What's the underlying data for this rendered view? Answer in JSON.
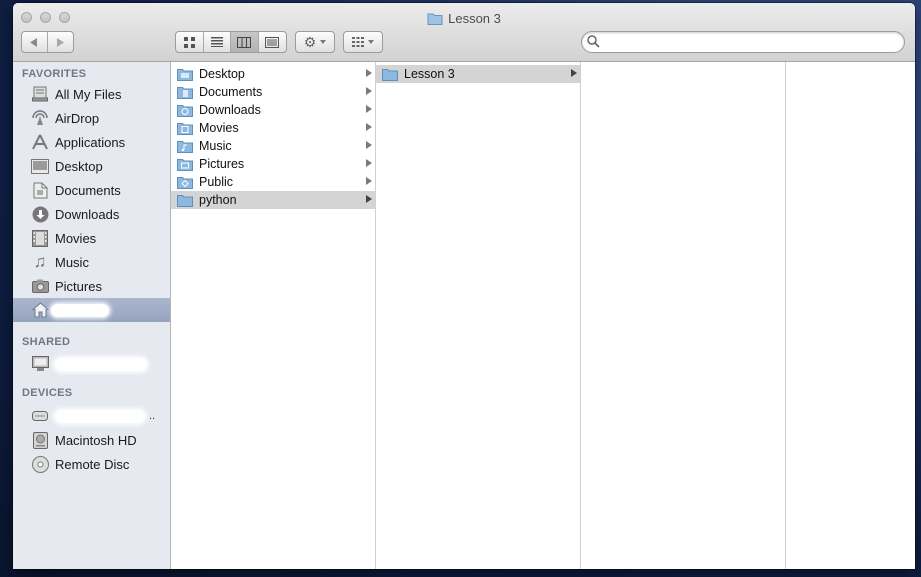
{
  "window": {
    "title": "Lesson 3"
  },
  "toolbar": {
    "search_placeholder": "",
    "view_modes": [
      "icon-view",
      "list-view",
      "column-view",
      "cover-flow-view"
    ],
    "selected_view": "column-view"
  },
  "sidebar": {
    "favorites_header": "FAVORITES",
    "favorites": [
      {
        "label": "All My Files",
        "icon": "all-files-icon"
      },
      {
        "label": "AirDrop",
        "icon": "airdrop-icon"
      },
      {
        "label": "Applications",
        "icon": "applications-icon"
      },
      {
        "label": "Desktop",
        "icon": "desktop-icon"
      },
      {
        "label": "Documents",
        "icon": "documents-icon"
      },
      {
        "label": "Downloads",
        "icon": "downloads-icon"
      },
      {
        "label": "Movies",
        "icon": "movies-icon"
      },
      {
        "label": "Music",
        "icon": "music-icon"
      },
      {
        "label": "Pictures",
        "icon": "pictures-icon"
      }
    ],
    "home_selected": true,
    "shared_header": "SHARED",
    "devices_header": "DEVICES",
    "devices": [
      {
        "label": "Macintosh HD",
        "icon": "hard-drive-icon"
      },
      {
        "label": "Remote Disc",
        "icon": "disc-icon"
      }
    ]
  },
  "columns": {
    "col1": [
      {
        "label": "Desktop"
      },
      {
        "label": "Documents"
      },
      {
        "label": "Downloads"
      },
      {
        "label": "Movies"
      },
      {
        "label": "Music"
      },
      {
        "label": "Pictures"
      },
      {
        "label": "Public"
      },
      {
        "label": "python"
      }
    ],
    "col1_selected": "python",
    "col2": [
      {
        "label": "Lesson 3"
      }
    ],
    "col2_selected": "Lesson 3"
  },
  "colors": {
    "selection": "#d4d4d4",
    "sidebar_selection": "#9aa8c2",
    "folder": "#7aaad6"
  }
}
